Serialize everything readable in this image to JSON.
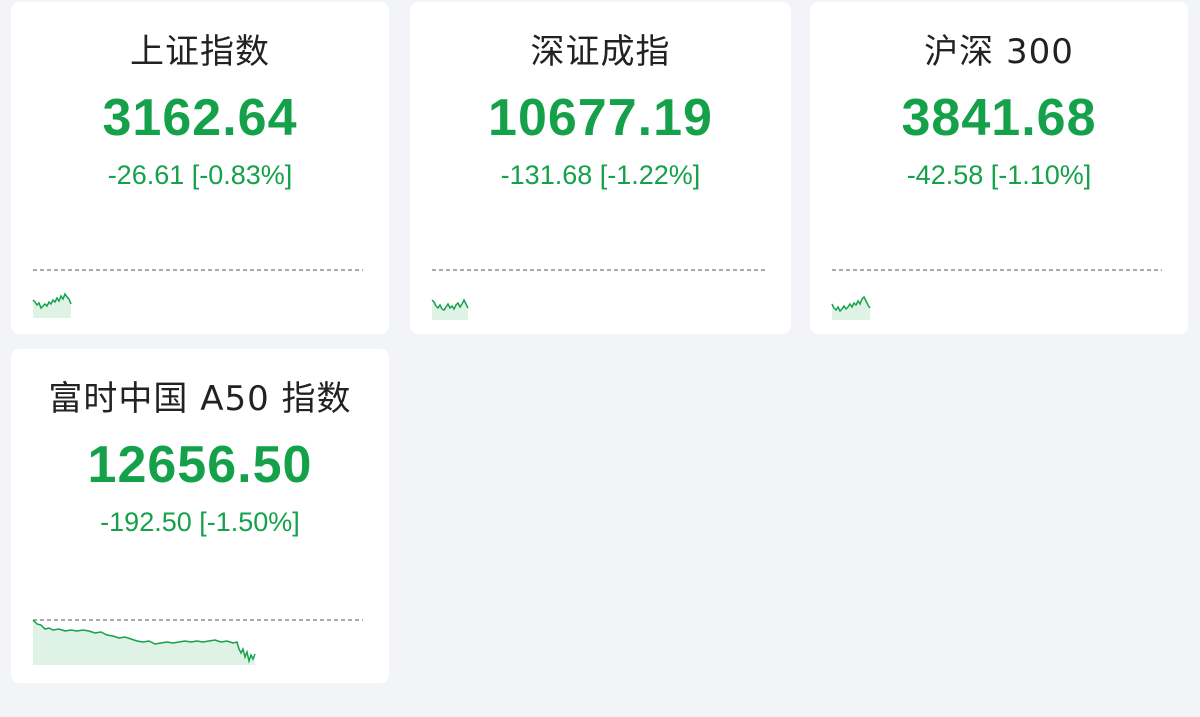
{
  "colors": {
    "down": "#15a14a",
    "background": "#f3f4f8",
    "card": "#ffffff"
  },
  "indices": [
    {
      "name": "上证指数",
      "value": "3162.64",
      "change": "-26.61 [-0.83%]"
    },
    {
      "name": "深证成指",
      "value": "10677.19",
      "change": "-131.68 [-1.22%]"
    },
    {
      "name": "沪深 300",
      "value": "3841.68",
      "change": "-42.58 [-1.10%]"
    },
    {
      "name": "富时中国 A50 指数",
      "value": "12656.50",
      "change": "-192.50 [-1.50%]"
    }
  ]
}
